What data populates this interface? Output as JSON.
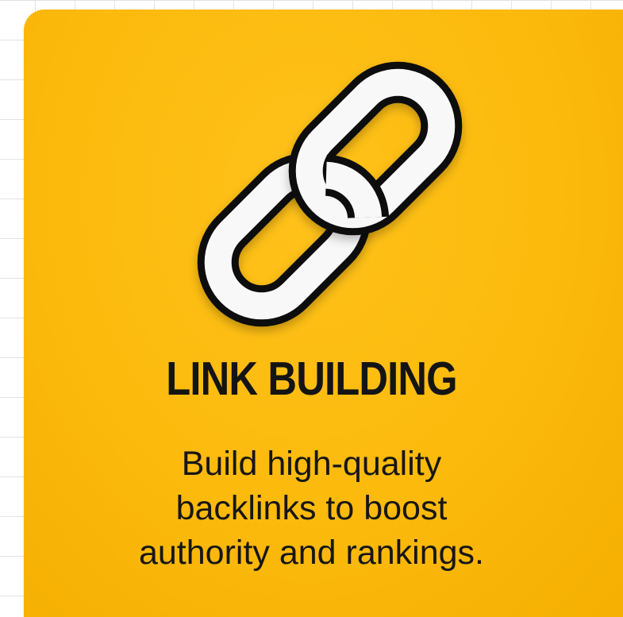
{
  "card": {
    "background_color": "#fbb90b",
    "icon": "chain-link-icon",
    "title": "LINK BUILDING",
    "description_lines": [
      "Build high-quality",
      "backlinks to boost",
      "authority and rankings."
    ]
  }
}
